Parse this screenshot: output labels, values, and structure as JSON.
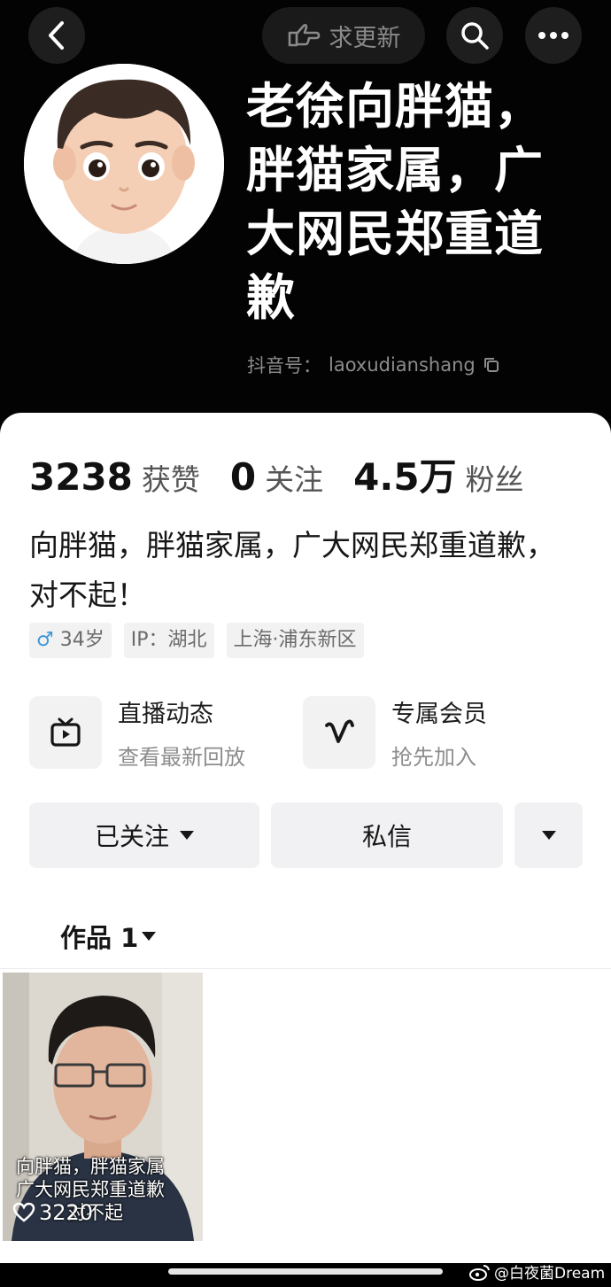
{
  "header": {
    "update_request_label": "求更新",
    "icons": [
      "back-icon",
      "hand-point-icon",
      "search-icon",
      "more-icon"
    ]
  },
  "profile": {
    "name": "老徐向胖猫，胖猫家属，广大网民郑重道歉",
    "id_label": "抖音号：",
    "id_value": "laoxudianshang"
  },
  "stats": [
    {
      "value": "3238",
      "label": "获赞"
    },
    {
      "value": "0",
      "label": "关注"
    },
    {
      "value": "4.5万",
      "label": "粉丝"
    }
  ],
  "bio": "向胖猫，胖猫家属，广大网民郑重道歉，对不起！",
  "tags": {
    "gender_symbol": "♂",
    "age": "34岁",
    "ip": "IP：湖北",
    "location": "上海·浦东新区"
  },
  "features": [
    {
      "title": "直播动态",
      "subtitle": "查看最新回放",
      "icon": "tv-icon"
    },
    {
      "title": "专属会员",
      "subtitle": "抢先加入",
      "icon": "v-icon"
    }
  ],
  "actions": {
    "follow_label": "已关注",
    "message_label": "私信"
  },
  "tab": {
    "label": "作品 1"
  },
  "video": {
    "caption_line1": "向胖猫，胖猫家属",
    "caption_line2": "广大网民郑重道歉",
    "caption_line3": "对不起",
    "likes": "3220"
  },
  "watermark": "@白夜菌Dream",
  "colors": {
    "hero_bg": "#030303",
    "sheet_bg": "#ffffff",
    "male_tag": "#3f97d6"
  }
}
